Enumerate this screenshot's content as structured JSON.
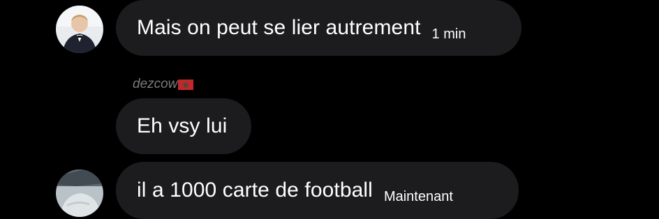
{
  "messages": [
    {
      "text": "Mais on peut se lier autrement",
      "time": "1 min"
    },
    {
      "sender": "dezcow",
      "sender_flag_icon": "morocco-flag-icon",
      "text": "Eh vsy lui"
    },
    {
      "text": "il a 1000 carte de football",
      "time": "Maintenant"
    }
  ],
  "colors": {
    "background": "#000000",
    "bubble": "#1c1c1e",
    "text": "#ffffff",
    "sender": "#7a7a7a",
    "flag_red": "#c1272d",
    "flag_green": "#006233"
  }
}
